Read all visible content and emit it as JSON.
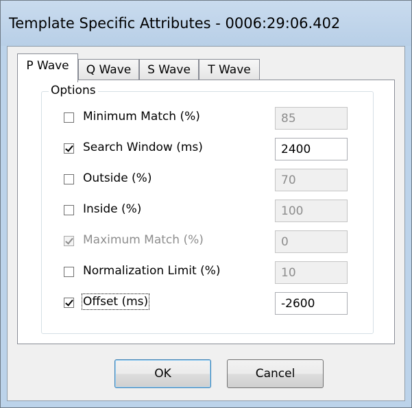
{
  "window": {
    "title": "Template Specific Attributes - 0006:29:06.402"
  },
  "tabs": [
    {
      "label": "P Wave",
      "selected": true
    },
    {
      "label": "Q Wave",
      "selected": false
    },
    {
      "label": "S Wave",
      "selected": false
    },
    {
      "label": "T Wave",
      "selected": false
    }
  ],
  "options": {
    "legend": "Options",
    "rows": [
      {
        "label": "Minimum Match (%)",
        "checked": false,
        "enabled": true,
        "value": "85",
        "field_enabled": false
      },
      {
        "label": "Search Window (ms)",
        "checked": true,
        "enabled": true,
        "value": "2400",
        "field_enabled": true
      },
      {
        "label": "Outside (%)",
        "checked": false,
        "enabled": true,
        "value": "70",
        "field_enabled": false
      },
      {
        "label": "Inside (%)",
        "checked": false,
        "enabled": true,
        "value": "100",
        "field_enabled": false
      },
      {
        "label": "Maximum Match (%)",
        "checked": true,
        "enabled": false,
        "value": "0",
        "field_enabled": false
      },
      {
        "label": "Normalization Limit (%)",
        "checked": false,
        "enabled": true,
        "value": "10",
        "field_enabled": false
      },
      {
        "label": "Offset (ms)",
        "checked": true,
        "enabled": true,
        "value": "-2600",
        "field_enabled": true,
        "focused": true
      }
    ]
  },
  "buttons": {
    "ok_label": "OK",
    "cancel_label": "Cancel"
  }
}
